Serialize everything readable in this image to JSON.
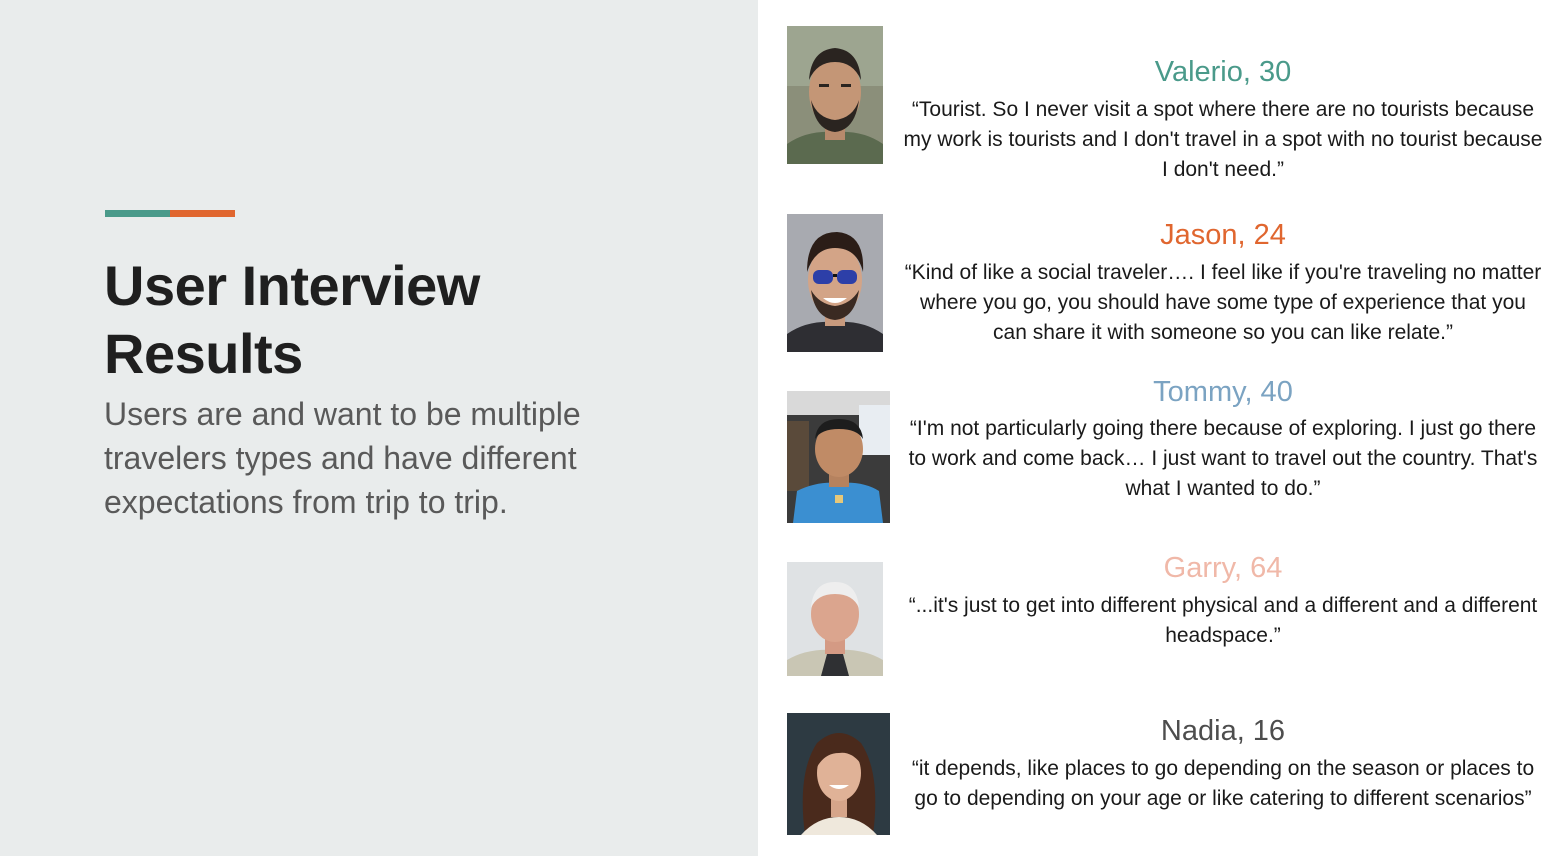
{
  "slide": {
    "title_line1": "User Interview",
    "title_line2": "Results",
    "subtitle": "Users are and want to be multiple travelers types and have different expectations from trip to trip.",
    "accent_colors": [
      "#4a9a8a",
      "#e0662f"
    ]
  },
  "interviews": [
    {
      "name": "Valerio, 30",
      "name_color": "#4a9a8a",
      "quote": "“Tourist. So I never visit a spot where there are no tourists because my work is tourists and I don't travel in a spot with no tourist because I don't need.”",
      "photo_icon": "man-beard-portrait"
    },
    {
      "name": "Jason, 24",
      "name_color": "#e0662f",
      "quote": "“Kind of like a social traveler…. I feel like if you're traveling no matter where you go, you should have some type of experience that you can share it with someone so you can like relate.”",
      "photo_icon": "man-sunglasses-portrait"
    },
    {
      "name": "Tommy, 40",
      "name_color": "#7ba3c2",
      "quote": "“I'm not particularly going there because of exploring. I just go there to work and come back… I just want to travel out the country. That's what I wanted to do.”",
      "photo_icon": "man-blue-shirt-portrait"
    },
    {
      "name": "Garry, 64",
      "name_color": "#f0b8a8",
      "quote": "“...it's just to get into different physical and a different and a different headspace.”",
      "photo_icon": "older-man-portrait"
    },
    {
      "name": "Nadia, 16",
      "name_color": "#4d4d4d",
      "quote": "“it depends,  like places to go depending on the season or places to go to depending on your age or like catering to different scenarios”",
      "photo_icon": "woman-smiling-portrait"
    }
  ]
}
